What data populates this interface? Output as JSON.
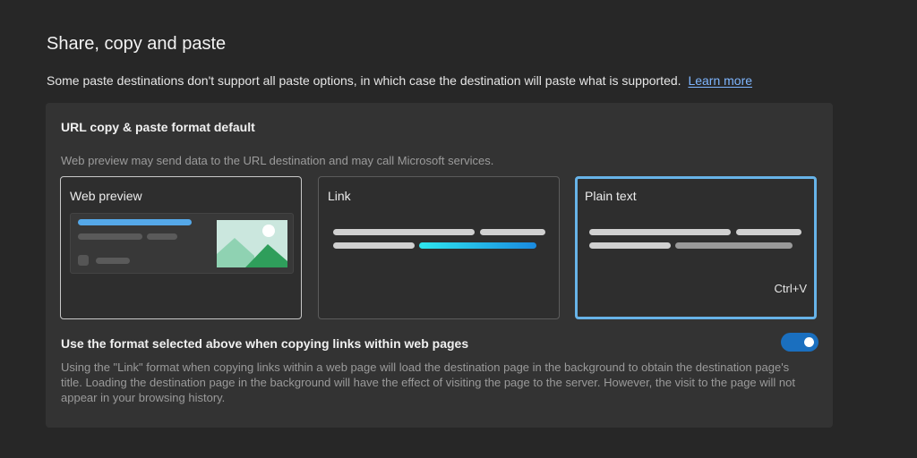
{
  "section": {
    "title": "Share, copy and paste",
    "description": "Some paste destinations don't support all paste options, in which case the destination will paste what is supported.",
    "learn_more": "Learn more"
  },
  "url_format": {
    "title": "URL copy & paste format default",
    "description": "Web preview may send data to the URL destination and may call Microsoft services.",
    "options": [
      {
        "label": "Web preview",
        "selected": false
      },
      {
        "label": "Link",
        "selected": false
      },
      {
        "label": "Plain text",
        "selected": true,
        "shortcut": "Ctrl+V"
      }
    ]
  },
  "links_setting": {
    "label": "Use the format selected above when copying links within web pages",
    "enabled": true,
    "description": "Using the \"Link\" format when copying links within a web page will load the destination page in the background to obtain the destination page's title. Loading the destination page in the background will have the effect of visiting the page to the server. However, the visit to the page will not appear in your browsing history."
  },
  "colors": {
    "accent": "#1a6fbf",
    "selected_border": "#67b3e8",
    "link_text": "#7fb6ff",
    "card_background": "#333333",
    "page_background": "#272727"
  }
}
